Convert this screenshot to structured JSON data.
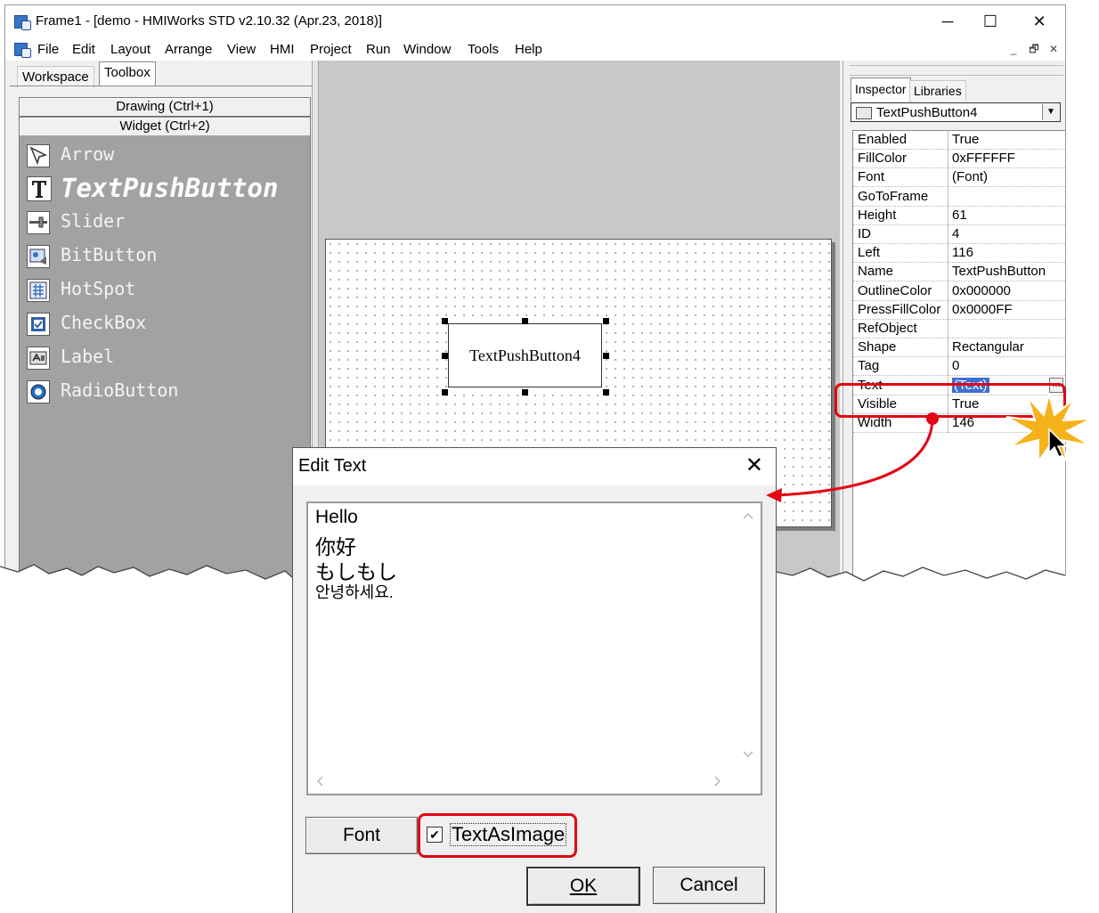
{
  "window": {
    "title": "Frame1 - [demo - HMIWorks STD v2.10.32 (Apr.23, 2018)]",
    "caption_buttons": {
      "minimize": "─",
      "maximize": "☐",
      "close": "✕"
    },
    "mdi_buttons": {
      "minimize": "_",
      "restore": "🗗",
      "close": "✕"
    }
  },
  "menu": [
    "File",
    "Edit",
    "Layout",
    "Arrange",
    "View",
    "HMI",
    "Project",
    "Run",
    "Window",
    "Tools",
    "Help"
  ],
  "left_pane": {
    "tabs": [
      "Workspace",
      "Toolbox"
    ],
    "active_tab": "Toolbox",
    "categories": [
      "Drawing (Ctrl+1)",
      "Widget (Ctrl+2)"
    ],
    "tools": [
      {
        "label": "Arrow",
        "icon": "arrow-icon"
      },
      {
        "label": "TextPushButton",
        "icon": "text-icon",
        "selected": true
      },
      {
        "label": "Slider",
        "icon": "slider-icon"
      },
      {
        "label": "BitButton",
        "icon": "bitbutton-icon"
      },
      {
        "label": "HotSpot",
        "icon": "hotspot-icon"
      },
      {
        "label": "CheckBox",
        "icon": "checkbox-icon"
      },
      {
        "label": "Label",
        "icon": "label-icon"
      },
      {
        "label": "RadioButton",
        "icon": "radiobutton-icon"
      }
    ]
  },
  "canvas": {
    "widget_text": "TextPushButton4"
  },
  "inspector": {
    "tabs": [
      "Inspector",
      "Libraries"
    ],
    "active_tab": "Inspector",
    "selected_object": "TextPushButton4",
    "properties": [
      {
        "name": "Enabled",
        "value": "True"
      },
      {
        "name": "FillColor",
        "value": "0xFFFFFF"
      },
      {
        "name": "Font",
        "value": "(Font)"
      },
      {
        "name": "GoToFrame",
        "value": ""
      },
      {
        "name": "Height",
        "value": "61"
      },
      {
        "name": "ID",
        "value": "4"
      },
      {
        "name": "Left",
        "value": "116"
      },
      {
        "name": "Name",
        "value": "TextPushButton"
      },
      {
        "name": "OutlineColor",
        "value": "0x000000"
      },
      {
        "name": "PressFillColor",
        "value": "0x0000FF"
      },
      {
        "name": "RefObject",
        "value": ""
      },
      {
        "name": "Shape",
        "value": "Rectangular"
      },
      {
        "name": "Tag",
        "value": "0"
      },
      {
        "name": "Text",
        "value": "(Text)",
        "selected": true
      },
      {
        "name": "Visible",
        "value": "True"
      },
      {
        "name": "Width",
        "value": "146"
      }
    ],
    "ellipsis_label": "..."
  },
  "dialog": {
    "title": "Edit Text",
    "close_label": "✕",
    "text_lines": [
      "Hello",
      "你好",
      "もしもし",
      "안녕하세요."
    ],
    "font_button": "Font",
    "checkbox_label": "TextAsImage",
    "checkbox_checked": true,
    "checkbox_mark": "✔",
    "ok_button": "OK",
    "cancel_button": "Cancel"
  },
  "colors": {
    "highlight_red": "#e30613",
    "toolbox_bg": "#a2a2a2",
    "selection_blue": "#3e6fd6",
    "starburst": "#f6b21b"
  }
}
